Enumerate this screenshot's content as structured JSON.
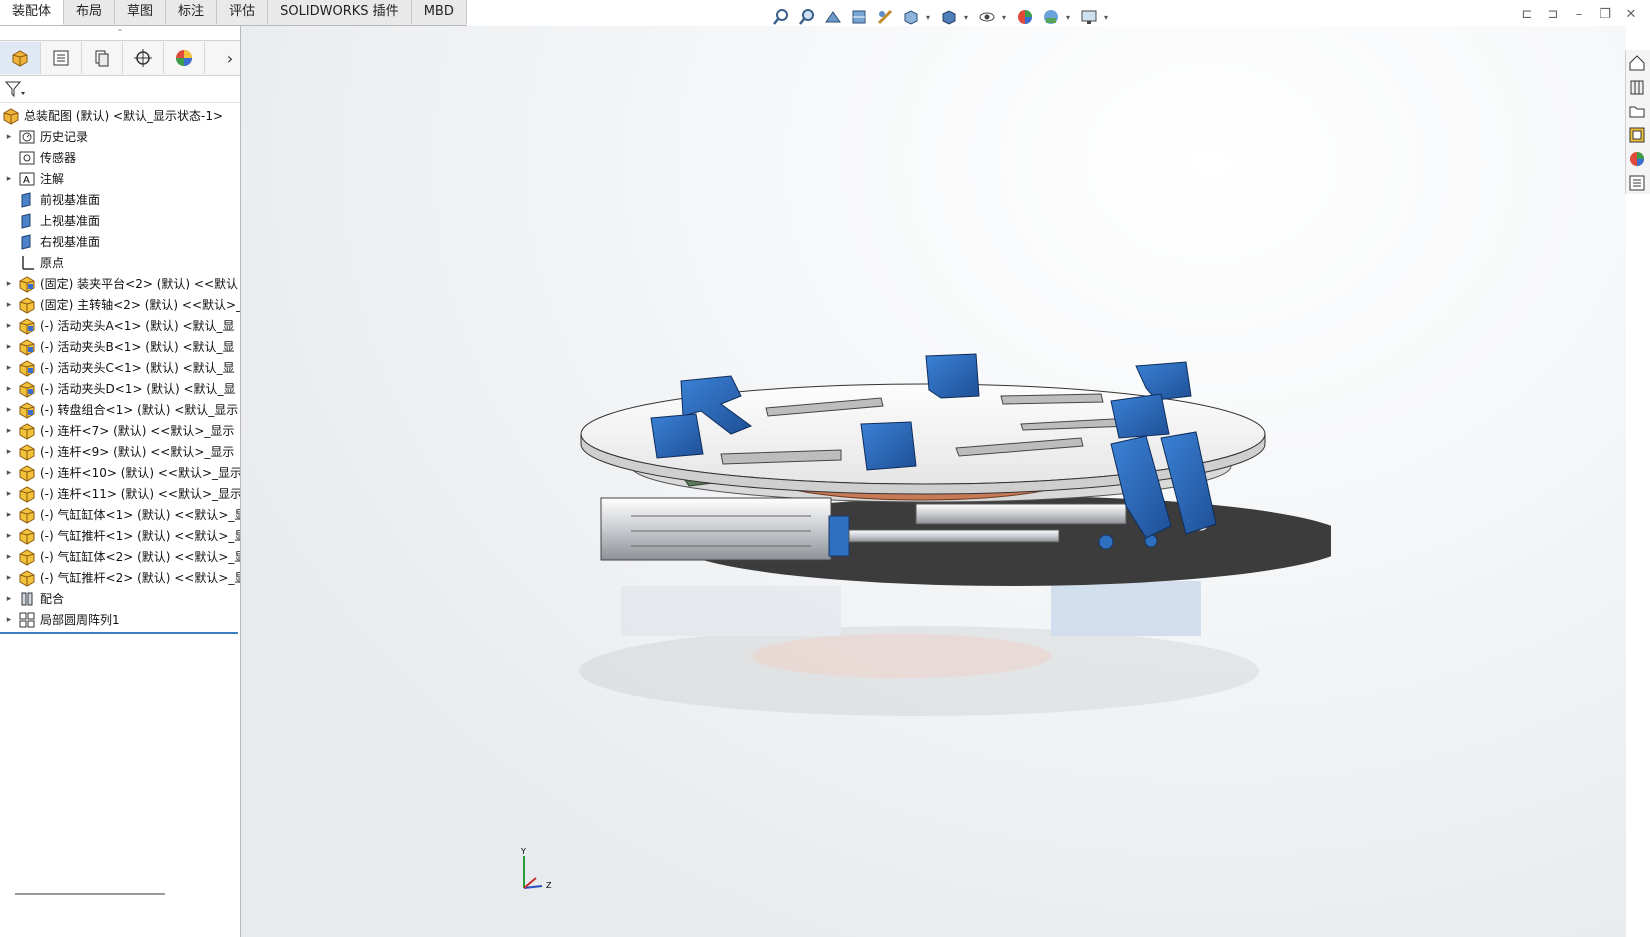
{
  "command_tabs": [
    {
      "label": "装配体",
      "active": true
    },
    {
      "label": "布局",
      "active": false
    },
    {
      "label": "草图",
      "active": false
    },
    {
      "label": "标注",
      "active": false
    },
    {
      "label": "评估",
      "active": false
    },
    {
      "label": "SOLIDWORKS 插件",
      "active": false
    },
    {
      "label": "MBD",
      "active": false
    }
  ],
  "hud_icons": [
    "zoom-to-fit-icon",
    "zoom-to-area-icon",
    "previous-view-icon",
    "section-view-icon",
    "dynamic-annotation-icon",
    "view-orientation-icon",
    "display-style-icon",
    "hide-show-items-icon",
    "edit-appearance-icon",
    "apply-scene-icon",
    "view-settings-icon"
  ],
  "feature_manager": {
    "tabs": [
      "featuremanager-icon",
      "propertymanager-icon",
      "configurationmanager-icon",
      "dimxpertmanager-icon",
      "displaymanager-icon"
    ],
    "root": "总装配图 (默认) <默认_显示状态-1>",
    "items": [
      {
        "label": "历史记录",
        "icon": "history",
        "expandable": true
      },
      {
        "label": "传感器",
        "icon": "sensor",
        "expandable": false
      },
      {
        "label": "注解",
        "icon": "annotation",
        "expandable": true
      },
      {
        "label": "前视基准面",
        "icon": "plane",
        "expandable": false
      },
      {
        "label": "上视基准面",
        "icon": "plane",
        "expandable": false
      },
      {
        "label": "右视基准面",
        "icon": "plane",
        "expandable": false
      },
      {
        "label": "原点",
        "icon": "origin",
        "expandable": false
      },
      {
        "label": "(固定) 装夹平台<2> (默认) <<默认",
        "icon": "assembly",
        "expandable": true
      },
      {
        "label": "(固定) 主转轴<2> (默认) <<默认>_",
        "icon": "part",
        "expandable": true
      },
      {
        "label": "(-) 活动夹头A<1> (默认) <默认_显",
        "icon": "assembly",
        "expandable": true
      },
      {
        "label": "(-) 活动夹头B<1> (默认) <默认_显",
        "icon": "assembly",
        "expandable": true
      },
      {
        "label": "(-) 活动夹头C<1> (默认) <默认_显",
        "icon": "assembly",
        "expandable": true
      },
      {
        "label": "(-) 活动夹头D<1> (默认) <默认_显",
        "icon": "assembly",
        "expandable": true
      },
      {
        "label": "(-) 转盘组合<1> (默认) <默认_显示",
        "icon": "assembly",
        "expandable": true
      },
      {
        "label": "(-) 连杆<7> (默认) <<默认>_显示",
        "icon": "part",
        "expandable": true
      },
      {
        "label": "(-) 连杆<9> (默认) <<默认>_显示",
        "icon": "part",
        "expandable": true
      },
      {
        "label": "(-) 连杆<10> (默认) <<默认>_显示",
        "icon": "part",
        "expandable": true
      },
      {
        "label": "(-) 连杆<11> (默认) <<默认>_显示",
        "icon": "part",
        "expandable": true
      },
      {
        "label": "(-) 气缸缸体<1> (默认) <<默认>_显",
        "icon": "part",
        "expandable": true
      },
      {
        "label": "(-) 气缸推杆<1> (默认) <<默认>_显",
        "icon": "part",
        "expandable": true
      },
      {
        "label": "(-) 气缸缸体<2> (默认) <<默认>_显",
        "icon": "part",
        "expandable": true
      },
      {
        "label": "(-) 气缸推杆<2> (默认) <<默认>_显",
        "icon": "part",
        "expandable": true
      },
      {
        "label": "配合",
        "icon": "mates",
        "expandable": true
      },
      {
        "label": "局部圆周阵列1",
        "icon": "pattern",
        "expandable": true
      }
    ]
  },
  "task_pane_icons": [
    "solidworks-resources-icon",
    "design-library-icon",
    "file-explorer-icon",
    "view-palette-icon",
    "appearances-icon",
    "custom-properties-icon"
  ],
  "triad": {
    "y": "Y",
    "z": "Z"
  },
  "colors": {
    "accent": "#3c7ebf",
    "part_blue": "#2f6fc0",
    "disk": "#f2f2f2"
  }
}
